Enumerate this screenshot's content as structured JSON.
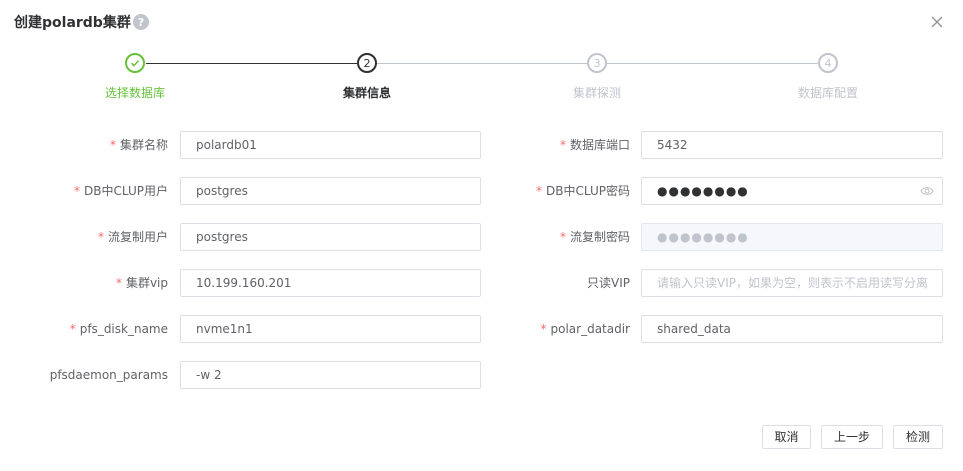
{
  "dialog": {
    "title": "创建polardb集群"
  },
  "steps": [
    {
      "index": "1",
      "label": "选择数据库",
      "status": "finished"
    },
    {
      "index": "2",
      "label": "集群信息",
      "status": "active"
    },
    {
      "index": "3",
      "label": "集群探测",
      "status": "pending"
    },
    {
      "index": "4",
      "label": "数据库配置",
      "status": "pending"
    }
  ],
  "form": {
    "cluster_name": {
      "label": "集群名称",
      "value": "polardb01",
      "required": true
    },
    "db_port": {
      "label": "数据库端口",
      "value": "5432",
      "required": true
    },
    "clup_user": {
      "label": "DB中CLUP用户",
      "value": "postgres",
      "required": true
    },
    "clup_password": {
      "label": "DB中CLUP密码",
      "value": "●●●●●●●●",
      "required": true
    },
    "repl_user": {
      "label": "流复制用户",
      "value": "postgres",
      "required": true
    },
    "repl_password": {
      "label": "流复制密码",
      "value": "●●●●●●●●",
      "required": true
    },
    "cluster_vip": {
      "label": "集群vip",
      "value": "10.199.160.201",
      "required": true
    },
    "readonly_vip": {
      "label": "只读VIP",
      "value": "",
      "placeholder": "请输入只读VIP，如果为空，则表示不启用读写分离",
      "required": false
    },
    "pfs_disk_name": {
      "label": "pfs_disk_name",
      "value": "nvme1n1",
      "required": true
    },
    "polar_datadir": {
      "label": "polar_datadir",
      "value": "shared_data",
      "required": true
    },
    "pfsdaemon_params": {
      "label": "pfsdaemon_params",
      "value": "-w 2",
      "required": false
    }
  },
  "buttons": {
    "cancel": "取消",
    "prev": "上一步",
    "detect": "检测"
  },
  "colors": {
    "finished": "#67c23a",
    "active": "#303133",
    "pending": "#c0c4cc",
    "required": "#f56c6c"
  }
}
